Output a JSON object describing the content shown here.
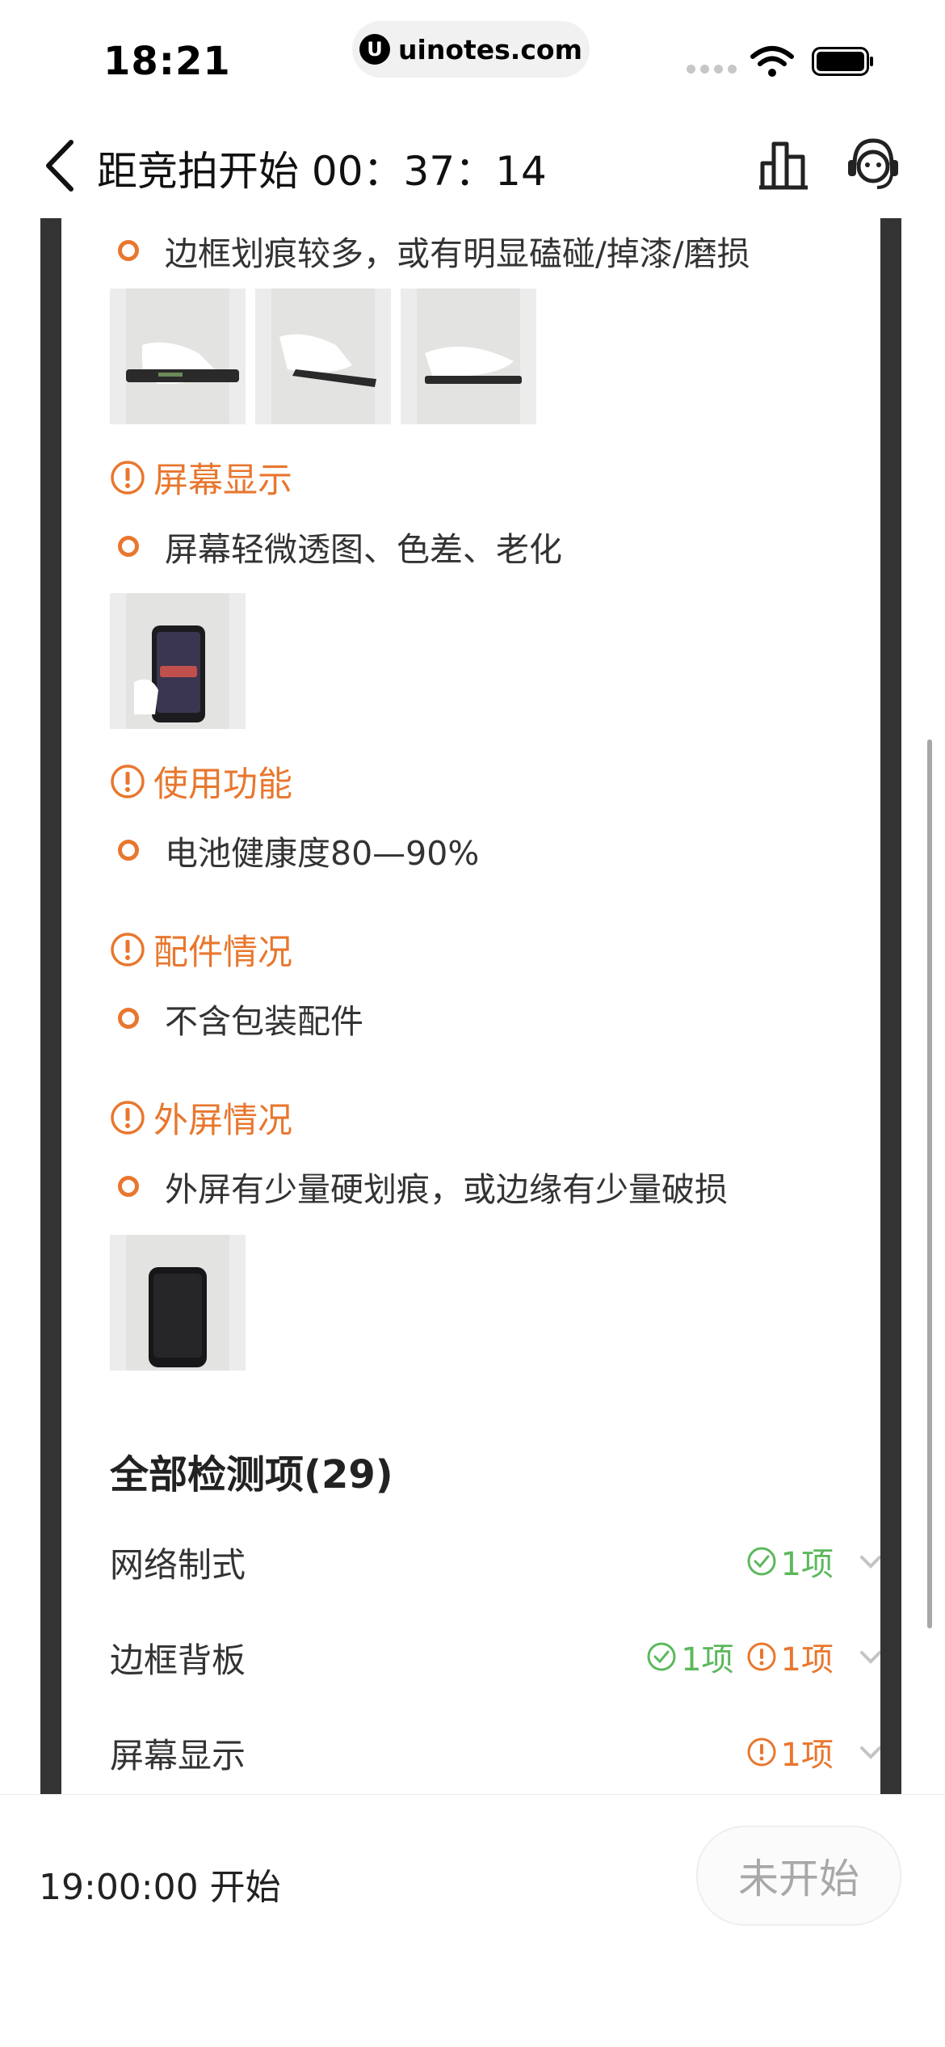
{
  "status_bar": {
    "time": "18:21",
    "url_logo": "U",
    "url": "uinotes.com"
  },
  "nav": {
    "title": "距竞拍开始 00：37：14",
    "icons": [
      "back-chevron-icon",
      "chart-bars-icon",
      "customer-service-icon"
    ]
  },
  "report": {
    "frame_item": "边框划痕较多，或有明显磕碰/掉漆/磨损",
    "categories": [
      {
        "title": "屏幕显示",
        "item": "屏幕轻微透图、色差、老化"
      },
      {
        "title": "使用功能",
        "item": "电池健康度80—90%"
      },
      {
        "title": "配件情况",
        "item": "不含包装配件"
      },
      {
        "title": "外屏情况",
        "item": "外屏有少量硬划痕，或边缘有少量破损"
      }
    ]
  },
  "all_checks": {
    "title": "全部检测项(29)",
    "rows": [
      {
        "name": "网络制式",
        "ok": "1项",
        "warn": ""
      },
      {
        "name": "边框背板",
        "ok": "1项",
        "warn": "1项"
      },
      {
        "name": "屏幕显示",
        "ok": "",
        "warn": "1项"
      }
    ]
  },
  "bottom": {
    "start_time": "19:00:00 开始",
    "button": "未开始"
  },
  "colors": {
    "accent": "#e8772e",
    "ok_green": "#5cb85c",
    "frame_dark": "#333333",
    "disabled_text": "#a8a8a8"
  }
}
